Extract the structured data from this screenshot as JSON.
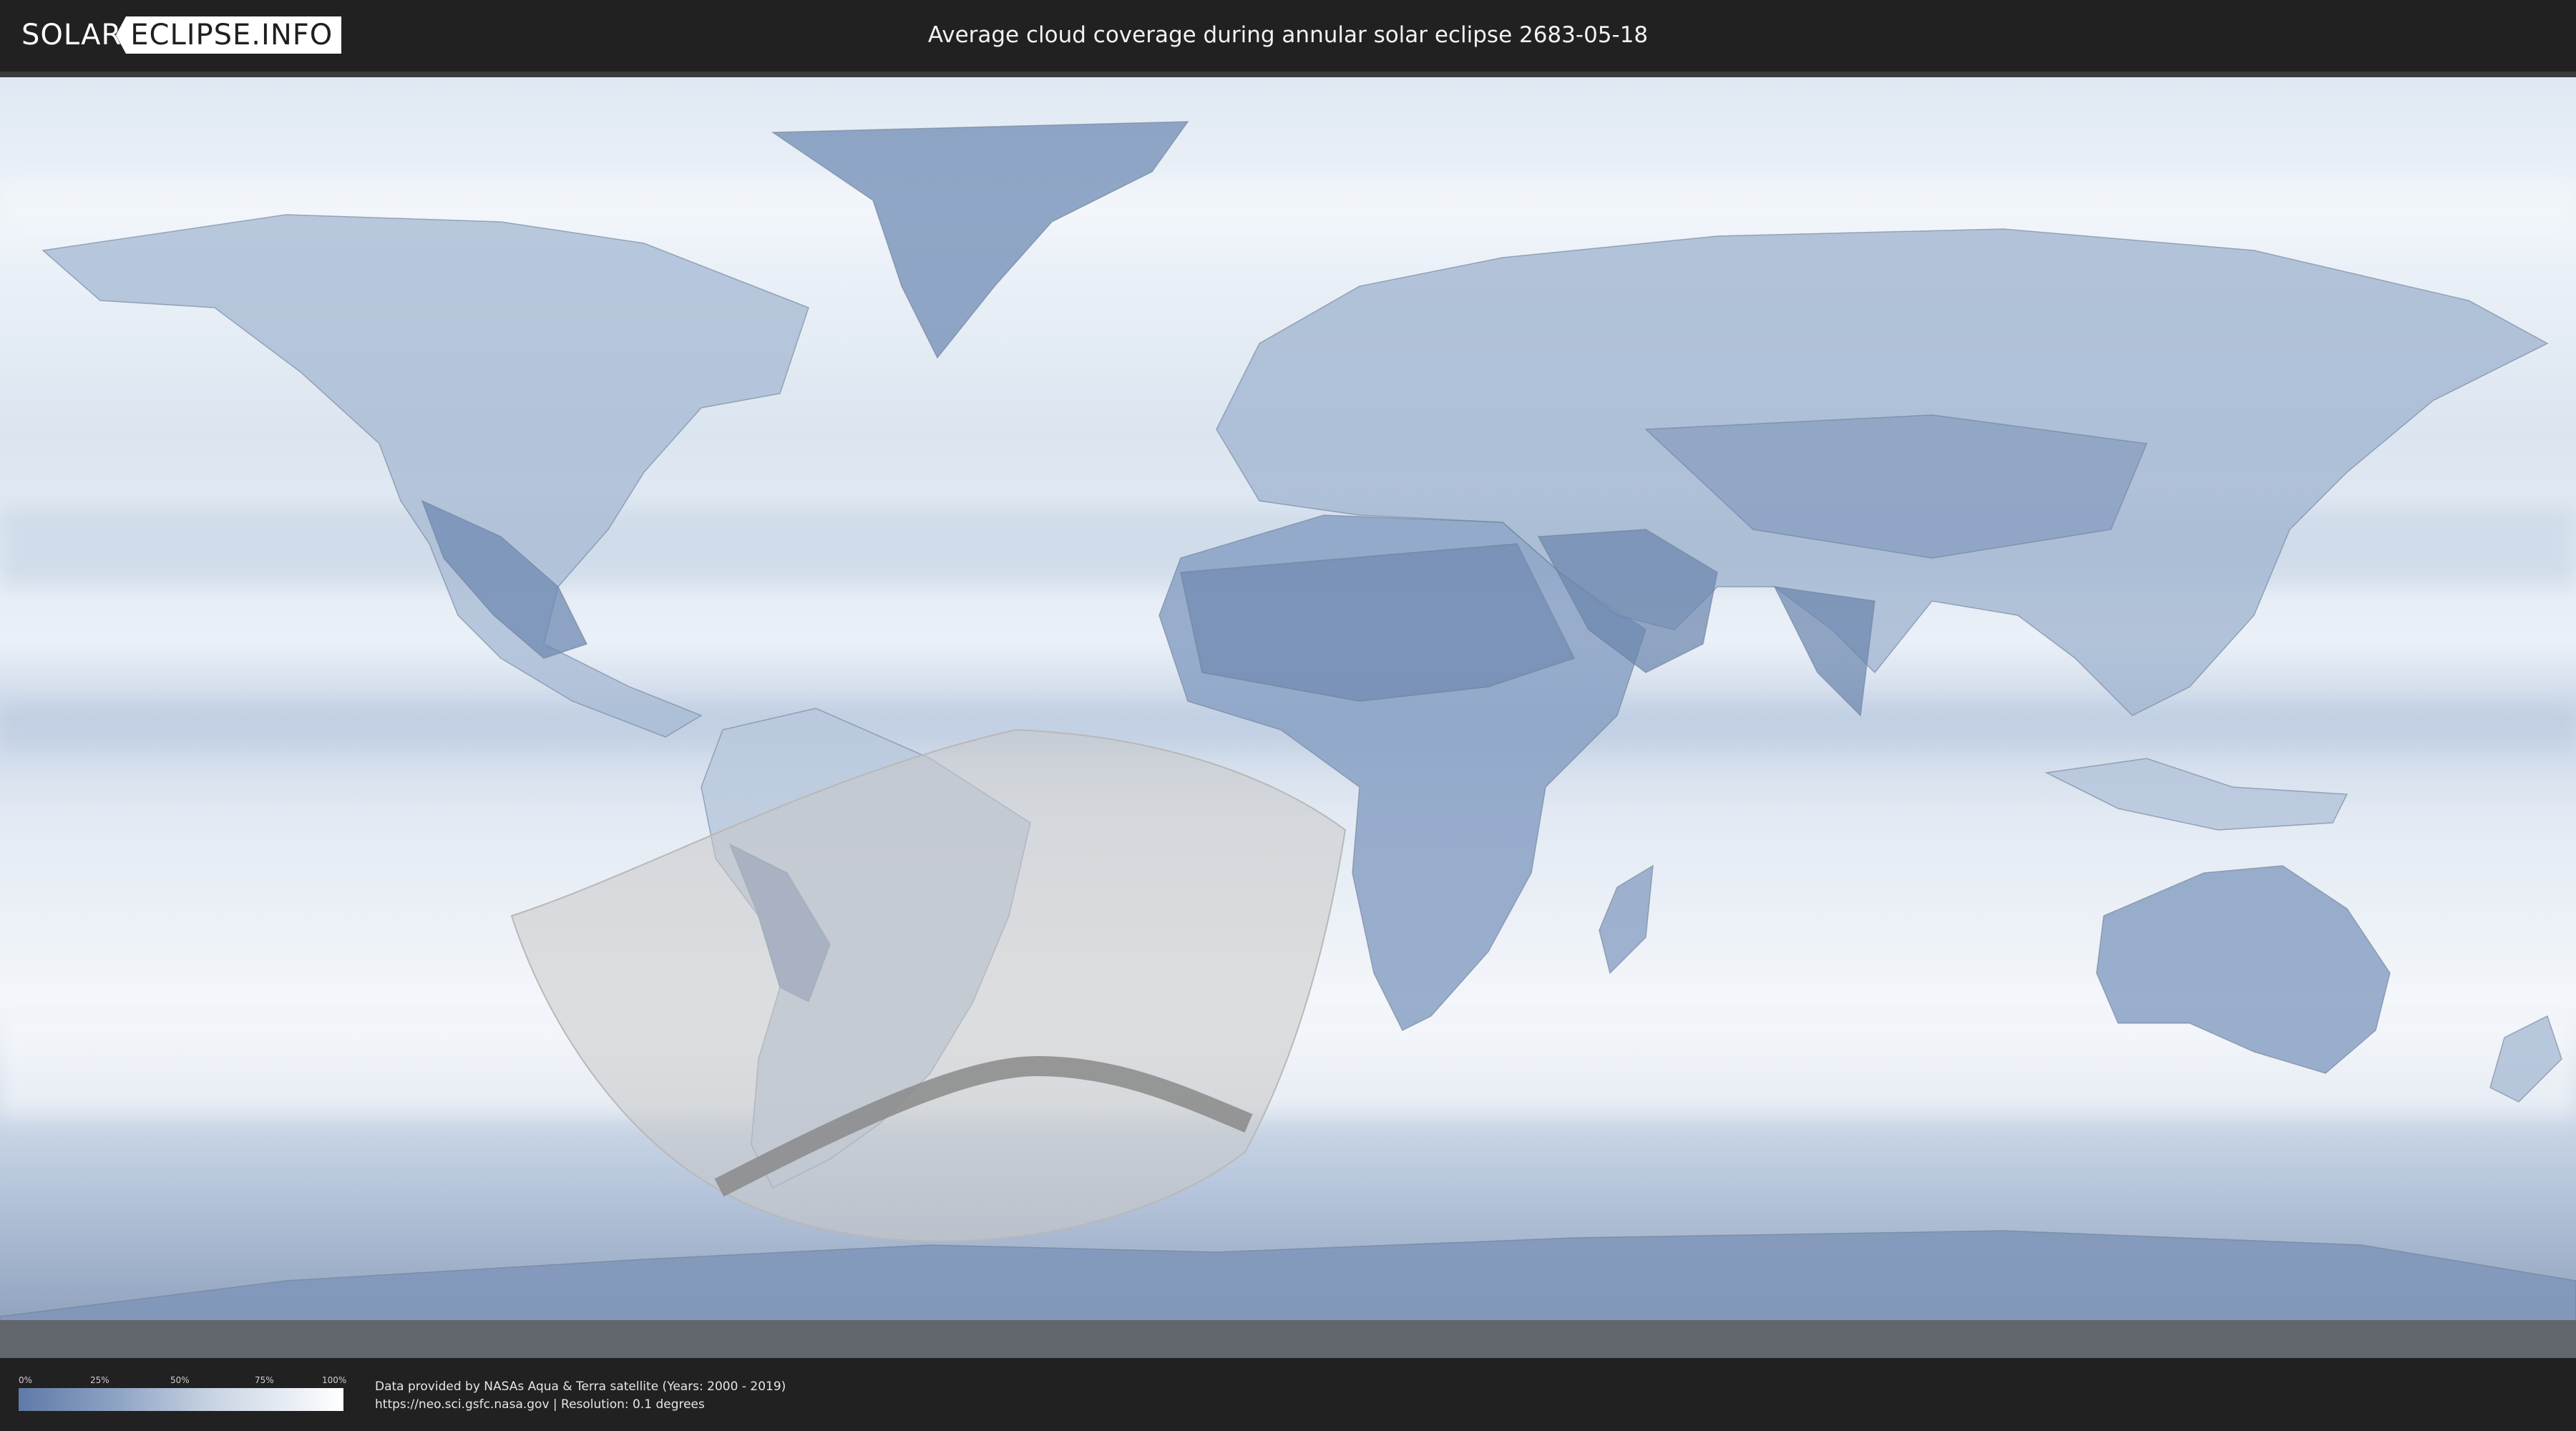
{
  "header": {
    "logo_left": "SOLAR",
    "logo_right": "ECLIPSE.INFO",
    "title": "Average cloud coverage during annular solar eclipse 2683-05-18"
  },
  "map": {
    "colors": {
      "clear_sky": "#5f7aa8",
      "full_cloud": "#ffffff",
      "shadow_overlay": "#c8c8c8",
      "path_of_annularity": "#8a8a8a"
    }
  },
  "legend": {
    "ticks": [
      "0%",
      "25%",
      "50%",
      "75%",
      "100%"
    ],
    "gradient": [
      "#5f7aa8",
      "#8ea3c4",
      "#c9d4e4",
      "#ffffff"
    ]
  },
  "footer": {
    "credit_line1": "Data provided by NASAs Aqua & Terra satellite (Years: 2000 - 2019)",
    "credit_line2": "https://neo.sci.gsfc.nasa.gov | Resolution: 0.1 degrees"
  }
}
